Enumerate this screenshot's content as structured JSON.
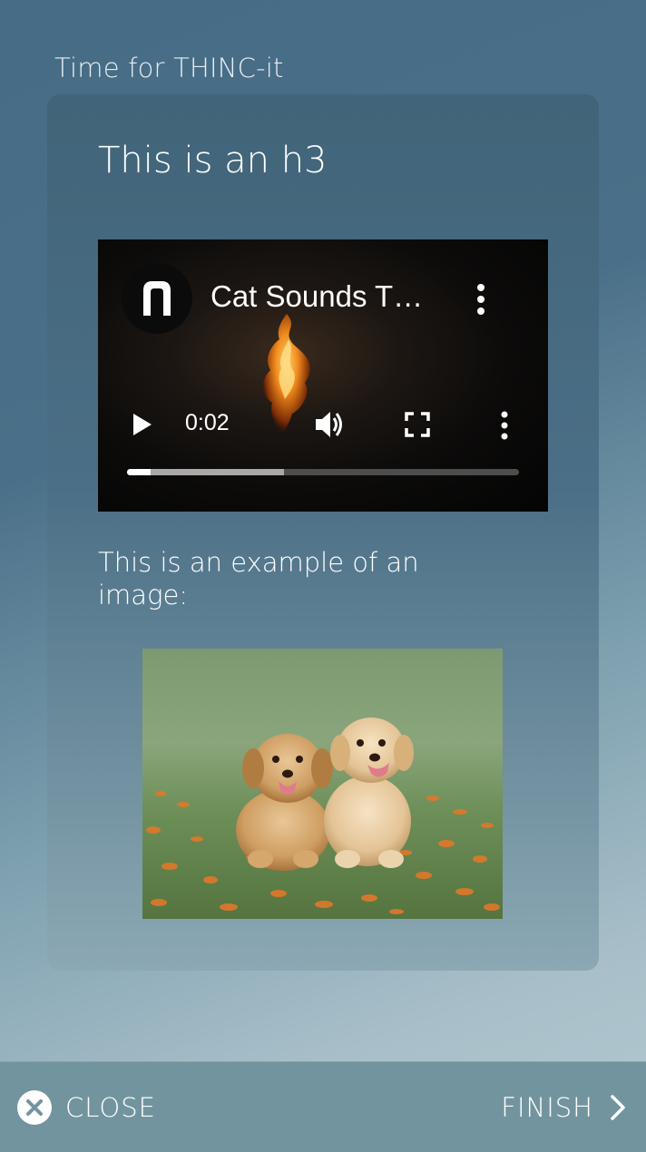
{
  "app": {
    "title": "Time for THINC-it"
  },
  "card": {
    "heading": "This is an h3",
    "video": {
      "title": "Cat Sounds T…",
      "time": "0:02",
      "progress_played": 0.06,
      "progress_buffered": 0.4,
      "icons": {
        "channel": "channel-logo-icon",
        "more_top": "more-vertical-icon",
        "play": "play-icon",
        "volume": "volume-icon",
        "fullscreen": "fullscreen-icon",
        "more_bottom": "more-vertical-icon"
      }
    },
    "body_text": "This is an example of an image:",
    "image": {
      "subject": "two golden retriever puppies sitting in grass with orange flowers"
    }
  },
  "footer": {
    "close_label": "CLOSE",
    "finish_label": "FINISH",
    "close_icon": "close-circle-icon",
    "finish_icon": "chevron-right-icon"
  },
  "colors": {
    "card_background": "#456a80",
    "footer_background": "#72949f",
    "text": "#ffffff"
  }
}
